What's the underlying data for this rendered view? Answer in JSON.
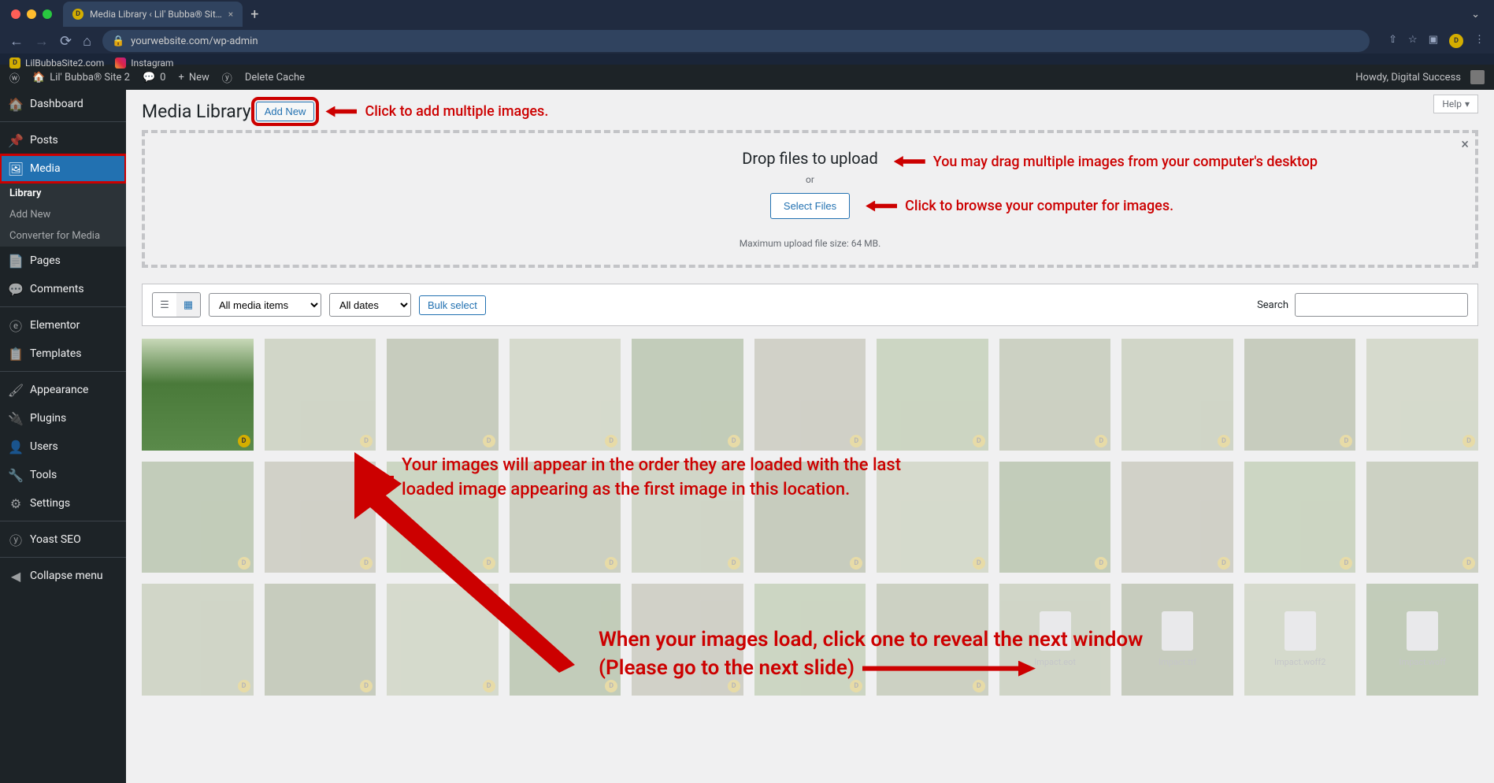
{
  "browser": {
    "tab_title": "Media Library ‹ Lil' Bubba® Sit…",
    "url": "yourwebsite.com/wp-admin",
    "bookmarks": [
      {
        "label": "LilBubbaSite2.com"
      },
      {
        "label": "Instagram"
      }
    ]
  },
  "adminbar": {
    "site_name": "Lil' Bubba® Site 2",
    "comments": "0",
    "new": "New",
    "delete_cache": "Delete Cache",
    "howdy": "Howdy, Digital Success"
  },
  "sidebar": {
    "items": [
      {
        "icon": "dashboard",
        "label": "Dashboard"
      },
      {
        "icon": "pin",
        "label": "Posts"
      },
      {
        "icon": "media",
        "label": "Media",
        "current": true
      },
      {
        "icon": "pages",
        "label": "Pages"
      },
      {
        "icon": "comments",
        "label": "Comments"
      },
      {
        "icon": "elementor",
        "label": "Elementor"
      },
      {
        "icon": "templates",
        "label": "Templates"
      },
      {
        "icon": "appearance",
        "label": "Appearance"
      },
      {
        "icon": "plugins",
        "label": "Plugins"
      },
      {
        "icon": "users",
        "label": "Users"
      },
      {
        "icon": "tools",
        "label": "Tools"
      },
      {
        "icon": "settings",
        "label": "Settings"
      },
      {
        "icon": "yoast",
        "label": "Yoast SEO"
      },
      {
        "icon": "collapse",
        "label": "Collapse menu"
      }
    ],
    "submenu": [
      {
        "label": "Library",
        "current": true
      },
      {
        "label": "Add New"
      },
      {
        "label": "Converter for Media"
      }
    ]
  },
  "page": {
    "title": "Media Library",
    "add_new": "Add New",
    "help": "Help"
  },
  "dropzone": {
    "title": "Drop files to upload",
    "or": "or",
    "select_files": "Select Files",
    "max_upload": "Maximum upload file size: 64 MB."
  },
  "filter": {
    "media_items": "All media items",
    "dates": "All dates",
    "bulk_select": "Bulk select",
    "search_label": "Search"
  },
  "files": [
    {
      "name": "Impact.eot"
    },
    {
      "name": "Impact.ttf"
    },
    {
      "name": "Impact.woff2"
    },
    {
      "name": "Impact.woff"
    }
  ],
  "annotations": {
    "add_new": "Click to add multiple images.",
    "drag": "You may drag multiple images from your computer's desktop",
    "select": "Click to browse your computer for images.",
    "order": "Your images will appear in the order they are loaded with the last loaded image appearing as the first image in this location.",
    "next1": "When your images load, click one to reveal the next window",
    "next2": "(Please go to the next slide)"
  }
}
